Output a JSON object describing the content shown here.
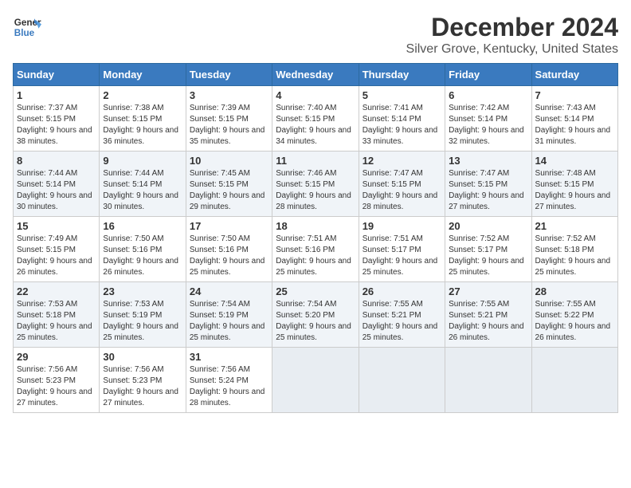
{
  "header": {
    "logo_line1": "General",
    "logo_line2": "Blue",
    "month_title": "December 2024",
    "location": "Silver Grove, Kentucky, United States"
  },
  "days_of_week": [
    "Sunday",
    "Monday",
    "Tuesday",
    "Wednesday",
    "Thursday",
    "Friday",
    "Saturday"
  ],
  "weeks": [
    [
      {
        "day": "1",
        "sunrise": "7:37 AM",
        "sunset": "5:15 PM",
        "daylight": "9 hours and 38 minutes."
      },
      {
        "day": "2",
        "sunrise": "7:38 AM",
        "sunset": "5:15 PM",
        "daylight": "9 hours and 36 minutes."
      },
      {
        "day": "3",
        "sunrise": "7:39 AM",
        "sunset": "5:15 PM",
        "daylight": "9 hours and 35 minutes."
      },
      {
        "day": "4",
        "sunrise": "7:40 AM",
        "sunset": "5:15 PM",
        "daylight": "9 hours and 34 minutes."
      },
      {
        "day": "5",
        "sunrise": "7:41 AM",
        "sunset": "5:14 PM",
        "daylight": "9 hours and 33 minutes."
      },
      {
        "day": "6",
        "sunrise": "7:42 AM",
        "sunset": "5:14 PM",
        "daylight": "9 hours and 32 minutes."
      },
      {
        "day": "7",
        "sunrise": "7:43 AM",
        "sunset": "5:14 PM",
        "daylight": "9 hours and 31 minutes."
      }
    ],
    [
      {
        "day": "8",
        "sunrise": "7:44 AM",
        "sunset": "5:14 PM",
        "daylight": "9 hours and 30 minutes."
      },
      {
        "day": "9",
        "sunrise": "7:44 AM",
        "sunset": "5:14 PM",
        "daylight": "9 hours and 30 minutes."
      },
      {
        "day": "10",
        "sunrise": "7:45 AM",
        "sunset": "5:15 PM",
        "daylight": "9 hours and 29 minutes."
      },
      {
        "day": "11",
        "sunrise": "7:46 AM",
        "sunset": "5:15 PM",
        "daylight": "9 hours and 28 minutes."
      },
      {
        "day": "12",
        "sunrise": "7:47 AM",
        "sunset": "5:15 PM",
        "daylight": "9 hours and 28 minutes."
      },
      {
        "day": "13",
        "sunrise": "7:47 AM",
        "sunset": "5:15 PM",
        "daylight": "9 hours and 27 minutes."
      },
      {
        "day": "14",
        "sunrise": "7:48 AM",
        "sunset": "5:15 PM",
        "daylight": "9 hours and 27 minutes."
      }
    ],
    [
      {
        "day": "15",
        "sunrise": "7:49 AM",
        "sunset": "5:15 PM",
        "daylight": "9 hours and 26 minutes."
      },
      {
        "day": "16",
        "sunrise": "7:50 AM",
        "sunset": "5:16 PM",
        "daylight": "9 hours and 26 minutes."
      },
      {
        "day": "17",
        "sunrise": "7:50 AM",
        "sunset": "5:16 PM",
        "daylight": "9 hours and 25 minutes."
      },
      {
        "day": "18",
        "sunrise": "7:51 AM",
        "sunset": "5:16 PM",
        "daylight": "9 hours and 25 minutes."
      },
      {
        "day": "19",
        "sunrise": "7:51 AM",
        "sunset": "5:17 PM",
        "daylight": "9 hours and 25 minutes."
      },
      {
        "day": "20",
        "sunrise": "7:52 AM",
        "sunset": "5:17 PM",
        "daylight": "9 hours and 25 minutes."
      },
      {
        "day": "21",
        "sunrise": "7:52 AM",
        "sunset": "5:18 PM",
        "daylight": "9 hours and 25 minutes."
      }
    ],
    [
      {
        "day": "22",
        "sunrise": "7:53 AM",
        "sunset": "5:18 PM",
        "daylight": "9 hours and 25 minutes."
      },
      {
        "day": "23",
        "sunrise": "7:53 AM",
        "sunset": "5:19 PM",
        "daylight": "9 hours and 25 minutes."
      },
      {
        "day": "24",
        "sunrise": "7:54 AM",
        "sunset": "5:19 PM",
        "daylight": "9 hours and 25 minutes."
      },
      {
        "day": "25",
        "sunrise": "7:54 AM",
        "sunset": "5:20 PM",
        "daylight": "9 hours and 25 minutes."
      },
      {
        "day": "26",
        "sunrise": "7:55 AM",
        "sunset": "5:21 PM",
        "daylight": "9 hours and 25 minutes."
      },
      {
        "day": "27",
        "sunrise": "7:55 AM",
        "sunset": "5:21 PM",
        "daylight": "9 hours and 26 minutes."
      },
      {
        "day": "28",
        "sunrise": "7:55 AM",
        "sunset": "5:22 PM",
        "daylight": "9 hours and 26 minutes."
      }
    ],
    [
      {
        "day": "29",
        "sunrise": "7:56 AM",
        "sunset": "5:23 PM",
        "daylight": "9 hours and 27 minutes."
      },
      {
        "day": "30",
        "sunrise": "7:56 AM",
        "sunset": "5:23 PM",
        "daylight": "9 hours and 27 minutes."
      },
      {
        "day": "31",
        "sunrise": "7:56 AM",
        "sunset": "5:24 PM",
        "daylight": "9 hours and 28 minutes."
      },
      null,
      null,
      null,
      null
    ]
  ],
  "labels": {
    "sunrise": "Sunrise:",
    "sunset": "Sunset:",
    "daylight": "Daylight:"
  }
}
